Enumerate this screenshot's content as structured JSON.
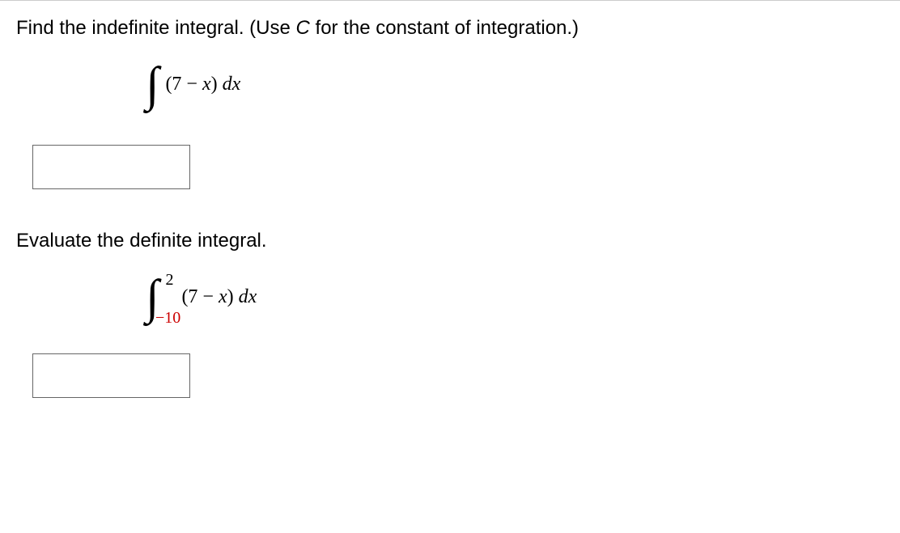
{
  "question1": {
    "prompt_before": "Find the indefinite integral. (Use ",
    "constant": "C",
    "prompt_after": " for the constant of integration.)",
    "integrand_open": "(7 − ",
    "integrand_var": "x",
    "integrand_close": ") ",
    "diff_d": "d",
    "diff_var": "x"
  },
  "question2": {
    "prompt": "Evaluate the definite integral.",
    "upper_bound": "2",
    "lower_bound": "−10",
    "integrand_open": "(7 − ",
    "integrand_var": "x",
    "integrand_close": ") ",
    "diff_d": "d",
    "diff_var": "x"
  }
}
